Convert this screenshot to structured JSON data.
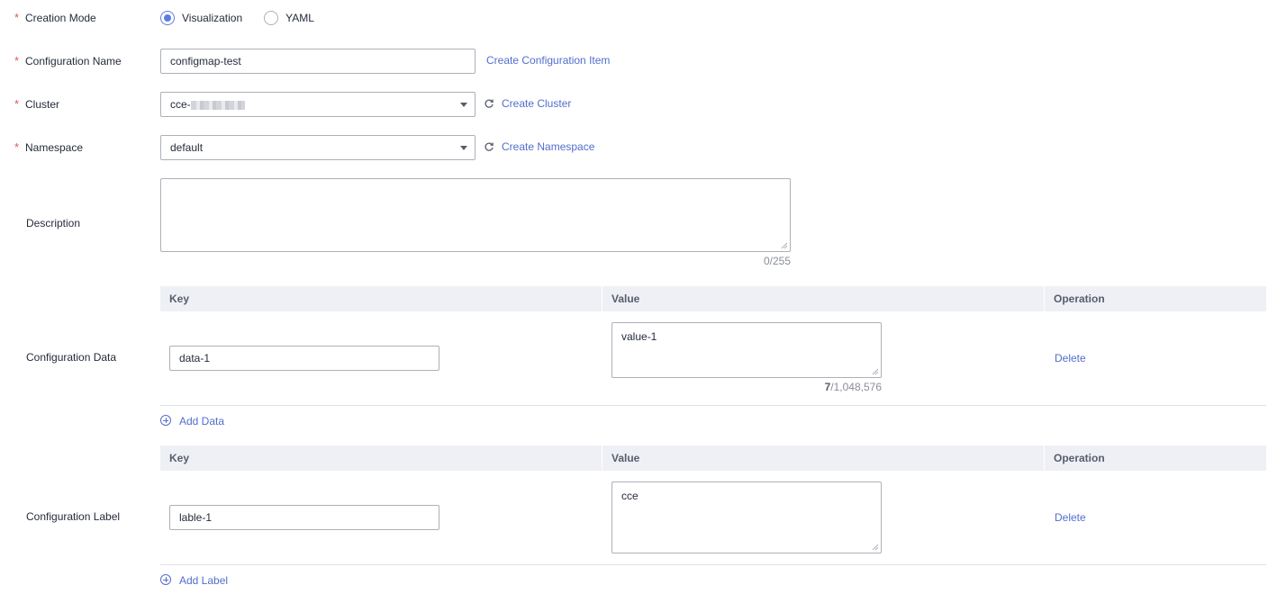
{
  "form": {
    "creation_mode": {
      "label": "Creation Mode",
      "options": [
        {
          "label": "Visualization",
          "checked": true
        },
        {
          "label": "YAML",
          "checked": false
        }
      ]
    },
    "configuration_name": {
      "label": "Configuration Name",
      "value": "configmap-test",
      "link": "Create Configuration Item"
    },
    "cluster": {
      "label": "Cluster",
      "value_prefix": "cce-",
      "link": "Create Cluster"
    },
    "namespace": {
      "label": "Namespace",
      "value": "default",
      "link": "Create Namespace"
    },
    "description": {
      "label": "Description",
      "value": "",
      "counter": "0/255"
    },
    "configuration_data": {
      "label": "Configuration Data",
      "headers": {
        "key": "Key",
        "value": "Value",
        "operation": "Operation"
      },
      "rows": [
        {
          "key": "data-1",
          "value": "value-1",
          "count": "7",
          "max": "/1,048,576",
          "operation": "Delete"
        }
      ],
      "add_label": "Add Data"
    },
    "configuration_label": {
      "label": "Configuration Label",
      "headers": {
        "key": "Key",
        "value": "Value",
        "operation": "Operation"
      },
      "rows": [
        {
          "key": "lable-1",
          "value": "cce",
          "operation": "Delete"
        }
      ],
      "add_label": "Add Label"
    }
  },
  "colors": {
    "required": "#e05a5a",
    "link": "#526ecc",
    "radio_checked": "#5e7ce0",
    "table_header_bg": "#eef0f5"
  }
}
